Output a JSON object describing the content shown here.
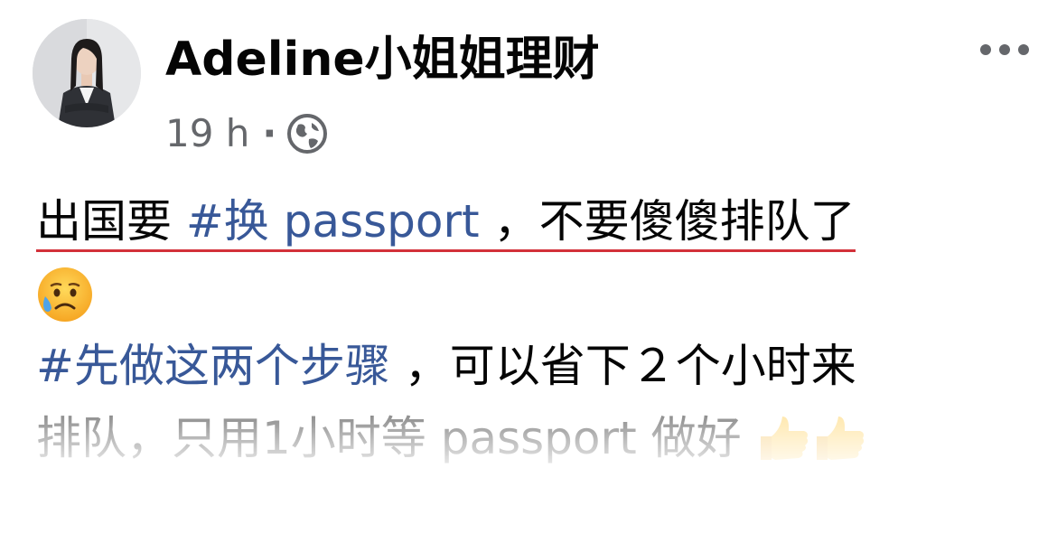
{
  "author": {
    "name": "Adeline小姐姐理财",
    "time": "19 h",
    "separator": "·",
    "audience_icon": "globe-icon"
  },
  "post": {
    "line1": {
      "prefix": "出国要 ",
      "hashtag": "#换 passport",
      "suffix": " ，不要傻傻排队了"
    },
    "line2_emoji": "sad-relieved-face-emoji",
    "line3": {
      "hashtag": "#先做这两个步骤",
      "suffix": " ，可以省下２个小时来"
    },
    "line4": {
      "text": "排队，只用1小时等 passport 做好",
      "emoji": "thumbs-up-emoji"
    }
  },
  "colors": {
    "text": "#050505",
    "meta": "#65676b",
    "hashtag": "#385898",
    "underline": "#d3313a"
  }
}
